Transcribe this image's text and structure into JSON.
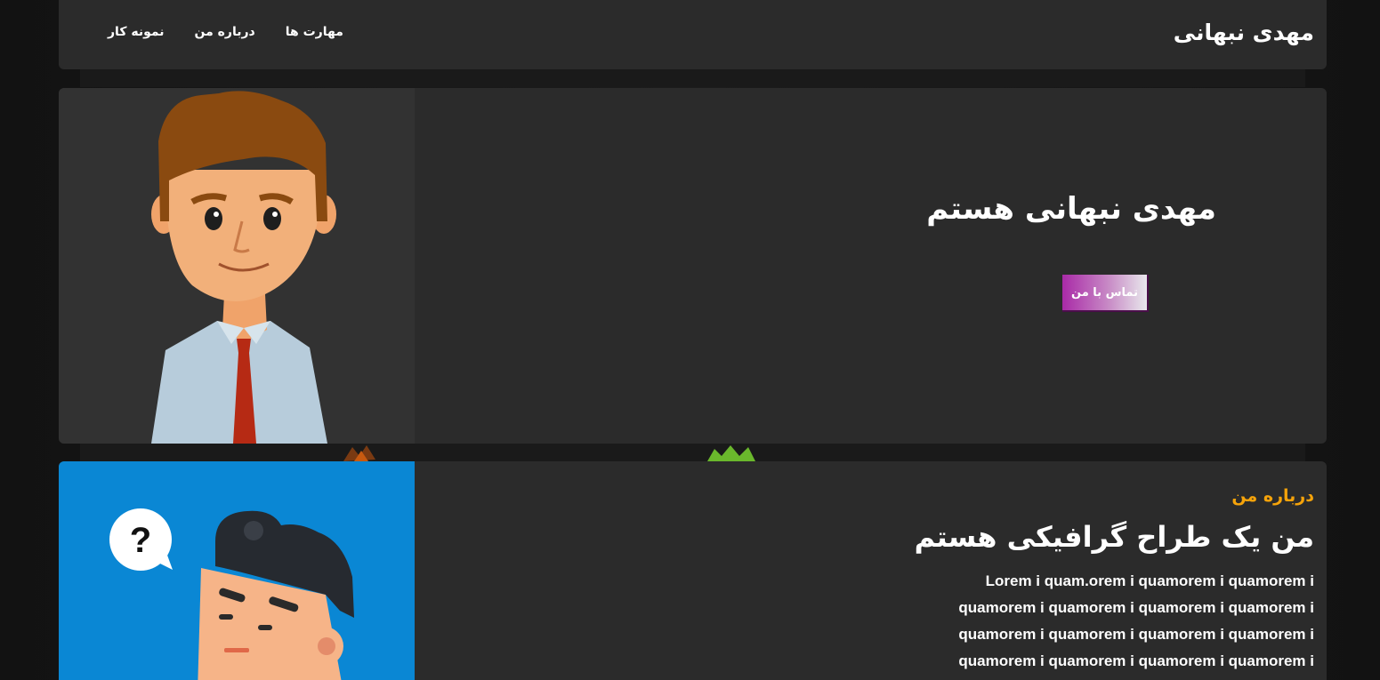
{
  "navbar": {
    "brand": "مهدی نبهانی",
    "links": [
      "نمونه کار",
      "درباره من",
      "مهارت ها"
    ]
  },
  "hero": {
    "title": "مهدی نبهانی هستم",
    "button_label": "تماس با من"
  },
  "about": {
    "kicker": "درباره من",
    "title": "من یک طراح گرافیکی هستم",
    "lines": [
      "Lorem i quam.orem i quamorem i quamorem i",
      "quamorem i quamorem i quamorem i quamorem i",
      "quamorem i quamorem i quamorem i quamorem i",
      "quamorem i quamorem i quamorem i quamorem i"
    ]
  },
  "colors": {
    "background": "#141414",
    "card": "#2b2b2b",
    "accent_orange": "#f5a30a",
    "button_purple": "#a92aa7",
    "about_image_bg": "#0a87d4"
  },
  "icons": [
    "cartoon-man-avatar",
    "thinking-man-illustration",
    "question-bubble-icon"
  ]
}
